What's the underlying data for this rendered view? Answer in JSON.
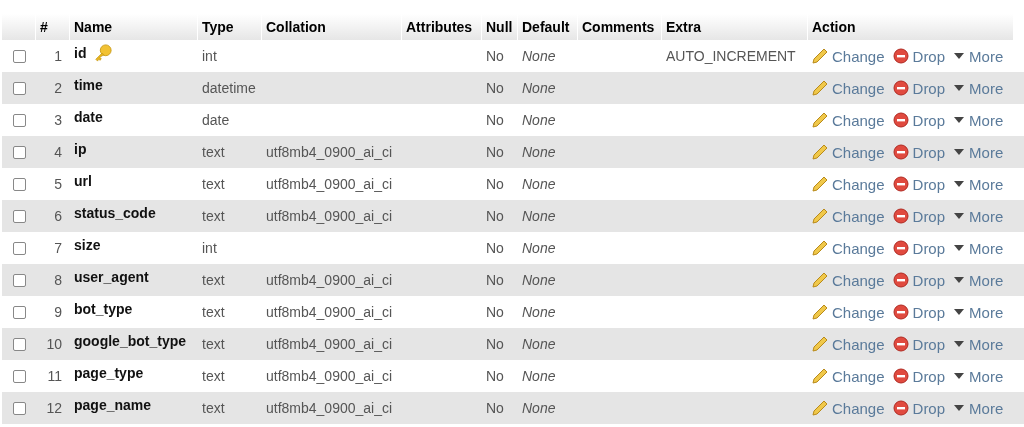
{
  "columns": [
    "#",
    "Name",
    "Type",
    "Collation",
    "Attributes",
    "Null",
    "Default",
    "Comments",
    "Extra",
    "Action"
  ],
  "rows": [
    {
      "checked": false,
      "index": "1",
      "name": "id",
      "primary_key": true,
      "type": "int",
      "collation": "",
      "null": "No",
      "default": "None",
      "extra": "AUTO_INCREMENT",
      "actions": [
        "Change",
        "Drop",
        "More"
      ]
    },
    {
      "checked": false,
      "index": "2",
      "name": "time",
      "primary_key": false,
      "type": "datetime",
      "collation": "",
      "null": "No",
      "default": "None",
      "extra": "",
      "actions": [
        "Change",
        "Drop",
        "More"
      ]
    },
    {
      "checked": false,
      "index": "3",
      "name": "date",
      "primary_key": false,
      "type": "date",
      "collation": "",
      "null": "No",
      "default": "None",
      "extra": "",
      "actions": [
        "Change",
        "Drop",
        "More"
      ]
    },
    {
      "checked": false,
      "index": "4",
      "name": "ip",
      "primary_key": false,
      "type": "text",
      "collation": "utf8mb4_0900_ai_ci",
      "null": "No",
      "default": "None",
      "extra": "",
      "actions": [
        "Change",
        "Drop",
        "More"
      ]
    },
    {
      "checked": false,
      "index": "5",
      "name": "url",
      "primary_key": false,
      "type": "text",
      "collation": "utf8mb4_0900_ai_ci",
      "null": "No",
      "default": "None",
      "extra": "",
      "actions": [
        "Change",
        "Drop",
        "More"
      ]
    },
    {
      "checked": false,
      "index": "6",
      "name": "status_code",
      "primary_key": false,
      "type": "text",
      "collation": "utf8mb4_0900_ai_ci",
      "null": "No",
      "default": "None",
      "extra": "",
      "actions": [
        "Change",
        "Drop",
        "More"
      ]
    },
    {
      "checked": false,
      "index": "7",
      "name": "size",
      "primary_key": false,
      "type": "int",
      "collation": "",
      "null": "No",
      "default": "None",
      "extra": "",
      "actions": [
        "Change",
        "Drop",
        "More"
      ]
    },
    {
      "checked": false,
      "index": "8",
      "name": "user_agent",
      "primary_key": false,
      "type": "text",
      "collation": "utf8mb4_0900_ai_ci",
      "null": "No",
      "default": "None",
      "extra": "",
      "actions": [
        "Change",
        "Drop",
        "More"
      ]
    },
    {
      "checked": false,
      "index": "9",
      "name": "bot_type",
      "primary_key": false,
      "type": "text",
      "collation": "utf8mb4_0900_ai_ci",
      "null": "No",
      "default": "None",
      "extra": "",
      "actions": [
        "Change",
        "Drop",
        "More"
      ]
    },
    {
      "checked": false,
      "index": "10",
      "name": "google_bot_type",
      "primary_key": false,
      "type": "text",
      "collation": "utf8mb4_0900_ai_ci",
      "null": "No",
      "default": "None",
      "extra": "",
      "actions": [
        "Change",
        "Drop",
        "More"
      ]
    },
    {
      "checked": false,
      "index": "11",
      "name": "page_type",
      "primary_key": false,
      "type": "text",
      "collation": "utf8mb4_0900_ai_ci",
      "null": "No",
      "default": "None",
      "extra": "",
      "actions": [
        "Change",
        "Drop",
        "More"
      ]
    },
    {
      "checked": false,
      "index": "12",
      "name": "page_name",
      "primary_key": false,
      "type": "text",
      "collation": "utf8mb4_0900_ai_ci",
      "null": "No",
      "default": "None",
      "extra": "",
      "actions": [
        "Change",
        "Drop",
        "More"
      ]
    }
  ]
}
